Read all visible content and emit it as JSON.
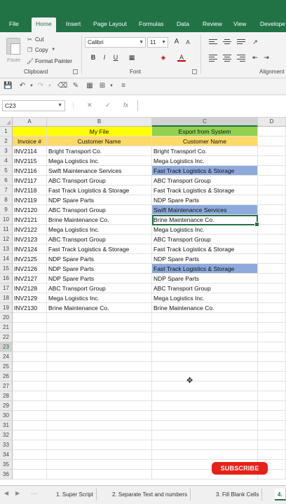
{
  "ribbon_tabs": [
    {
      "label": "File"
    },
    {
      "label": "Home"
    },
    {
      "label": "Insert"
    },
    {
      "label": "Page Layout"
    },
    {
      "label": "Formulas"
    },
    {
      "label": "Data"
    },
    {
      "label": "Review"
    },
    {
      "label": "View"
    },
    {
      "label": "Develope"
    }
  ],
  "active_tab": "Home",
  "clipboard": {
    "paste_label": "Paste",
    "cut_label": "Cut",
    "copy_label": "Copy",
    "format_painter_label": "Format Painter",
    "group_label": "Clipboard"
  },
  "font": {
    "font_name": "Calibri",
    "font_size": "11",
    "bold": "B",
    "italic": "I",
    "underline": "U",
    "group_label": "Font",
    "grow": "A",
    "shrink": "A",
    "font_color_glyph": "A"
  },
  "alignment": {
    "group_label": "Alignment"
  },
  "formula_bar": {
    "name_box": "C23",
    "cancel": "✕",
    "enter": "✓",
    "fx": "fx",
    "value": ""
  },
  "columns": [
    "A",
    "B",
    "C",
    "D"
  ],
  "selected_column": "C",
  "selected_row": "23",
  "header_row1": {
    "b": "My File",
    "c": "Export from System"
  },
  "header_row2": {
    "a": "Invoice #",
    "b": "Customer Name",
    "c": "Customer Name"
  },
  "data_rows": [
    {
      "invoice": "INV2114",
      "my_customer": "Bright Transport Co.",
      "export_customer": "Bright Transport Co.",
      "highlight": false
    },
    {
      "invoice": "INV2115",
      "my_customer": "Mega Logistics Inc.",
      "export_customer": "Mega Logistics Inc.",
      "highlight": false
    },
    {
      "invoice": "INV2116",
      "my_customer": "Swift Maintenance Services",
      "export_customer": "Fast Track Logistics & Storage",
      "highlight": true
    },
    {
      "invoice": "INV2117",
      "my_customer": "ABC Transport Group",
      "export_customer": "ABC Transport Group",
      "highlight": false
    },
    {
      "invoice": "INV2118",
      "my_customer": "Fast Track Logistics & Storage",
      "export_customer": "Fast Track Logistics & Storage",
      "highlight": false
    },
    {
      "invoice": "INV2119",
      "my_customer": "NDP Spare Parts",
      "export_customer": "NDP Spare Parts",
      "highlight": false
    },
    {
      "invoice": "INV2120",
      "my_customer": "ABC Transport Group",
      "export_customer": "Swift Maintenance Services",
      "highlight": true
    },
    {
      "invoice": "INV2121",
      "my_customer": "Brine Maintenance Co.",
      "export_customer": "Brine Maintenance Co.",
      "highlight": false
    },
    {
      "invoice": "INV2122",
      "my_customer": "Mega Logistics Inc.",
      "export_customer": "Mega Logistics Inc.",
      "highlight": false
    },
    {
      "invoice": "INV2123",
      "my_customer": "ABC Transport Group",
      "export_customer": "ABC Transport Group",
      "highlight": false
    },
    {
      "invoice": "INV2124",
      "my_customer": "Fast Track Logistics & Storage",
      "export_customer": "Fast Track Logistics & Storage",
      "highlight": false
    },
    {
      "invoice": "INV2125",
      "my_customer": "NDP Spare Parts",
      "export_customer": "NDP Spare Parts",
      "highlight": false
    },
    {
      "invoice": "INV2126",
      "my_customer": "NDP Spare Parts",
      "export_customer": "Fast Track Logistics & Storage",
      "highlight": true
    },
    {
      "invoice": "INV2127",
      "my_customer": "NDP Spare Parts",
      "export_customer": "NDP Spare Parts",
      "highlight": false
    },
    {
      "invoice": "INV2128",
      "my_customer": "ABC Transport Group",
      "export_customer": "ABC Transport Group",
      "highlight": false
    },
    {
      "invoice": "INV2129",
      "my_customer": "Mega Logistics Inc.",
      "export_customer": "Mega Logistics Inc.",
      "highlight": false
    },
    {
      "invoice": "INV2130",
      "my_customer": "Brine Maintenance Co.",
      "export_customer": "Brine Maintenance Co.",
      "highlight": false
    }
  ],
  "row_numbers": [
    "1",
    "2",
    "3",
    "4",
    "5",
    "6",
    "7",
    "8",
    "9",
    "10",
    "11",
    "12",
    "13",
    "14",
    "15",
    "16",
    "17",
    "18",
    "19",
    "20",
    "21",
    "22",
    "23",
    "24",
    "25",
    "26",
    "27",
    "28",
    "29",
    "30",
    "31",
    "32",
    "33",
    "34",
    "35",
    "36"
  ],
  "sheet_tabs": [
    {
      "label": "1. Super Script"
    },
    {
      "label": "2. Separate Text and numbers"
    },
    {
      "label": "3. Fill Blank Cells"
    },
    {
      "label": "4."
    }
  ],
  "subscribe_label": "SUBSCRIBE",
  "colors": {
    "excel_green": "#217346",
    "yellow_header": "#ffff00",
    "green_header": "#92d050",
    "tan_header": "#ffd966",
    "mismatch_highlight": "#8ea9db"
  }
}
